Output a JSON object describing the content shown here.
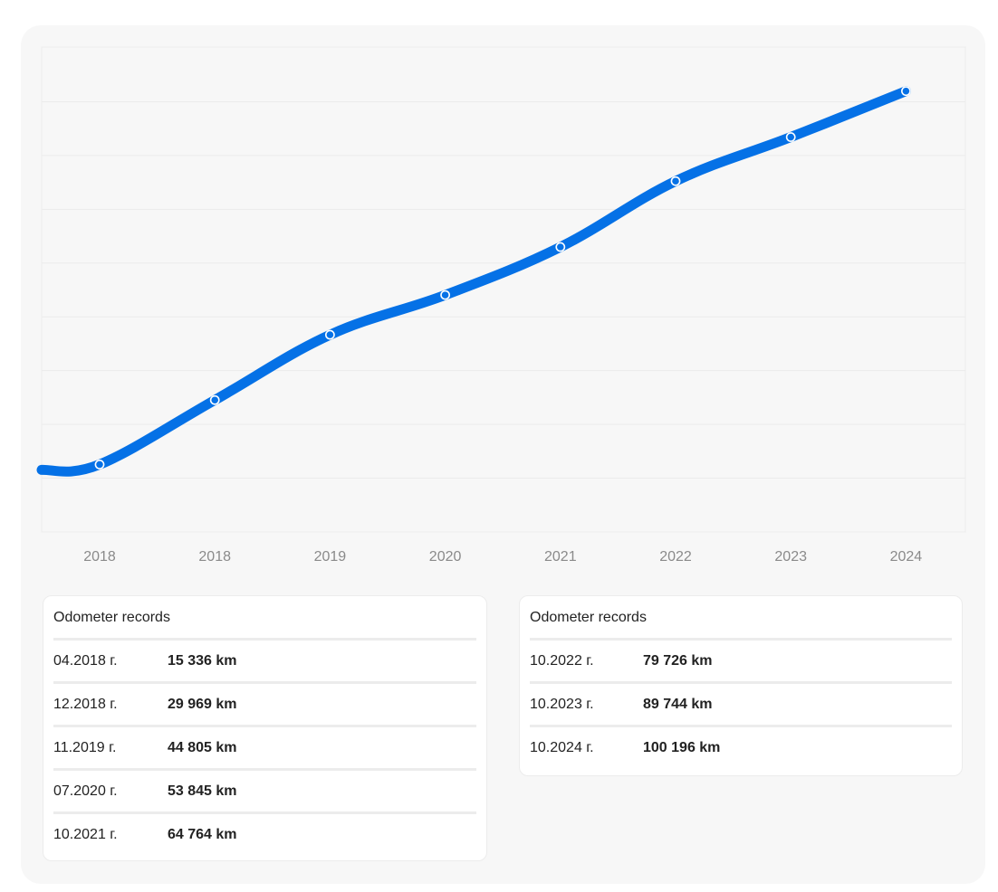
{
  "chart_data": {
    "type": "line",
    "x": [
      "04.2018",
      "12.2018",
      "11.2019",
      "07.2020",
      "10.2021",
      "10.2022",
      "10.2023",
      "10.2024"
    ],
    "x_tick_labels": [
      "2018",
      "2018",
      "2019",
      "2020",
      "2021",
      "2022",
      "2023",
      "2024"
    ],
    "y": [
      15336,
      29969,
      44805,
      53845,
      64764,
      79726,
      89744,
      100196
    ],
    "y_unit": "km",
    "ylim": [
      0,
      110000
    ],
    "grid": "horizontal",
    "legend": "none",
    "line_color": "#0571e6",
    "plot_background": "#f7f7f7"
  },
  "records_left": {
    "title": "Odometer records",
    "rows": [
      {
        "date": "04.2018 г.",
        "value": "15 336 km"
      },
      {
        "date": "12.2018 г.",
        "value": "29 969 km"
      },
      {
        "date": "11.2019 г.",
        "value": "44 805 km"
      },
      {
        "date": "07.2020 г.",
        "value": "53 845 km"
      },
      {
        "date": "10.2021 г.",
        "value": "64 764 km"
      }
    ]
  },
  "records_right": {
    "title": "Odometer records",
    "rows": [
      {
        "date": "10.2022 г.",
        "value": "79 726 km"
      },
      {
        "date": "10.2023 г.",
        "value": "89 744 km"
      },
      {
        "date": "10.2024 г.",
        "value": "100 196 km"
      }
    ]
  }
}
